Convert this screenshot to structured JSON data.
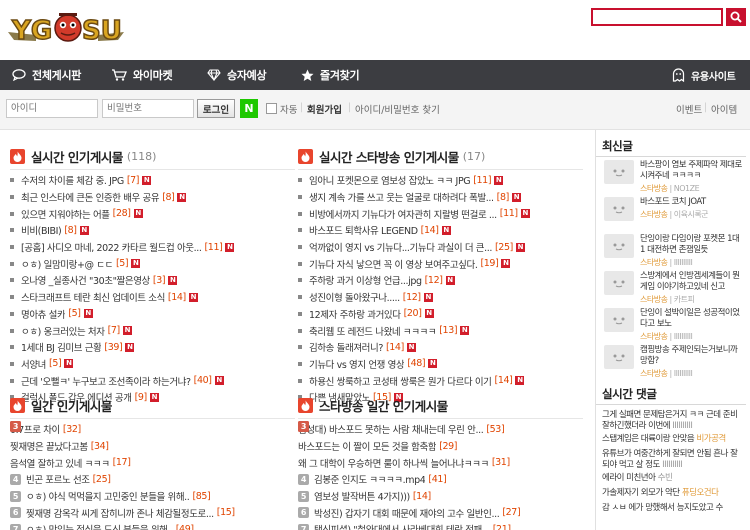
{
  "header": {
    "logo_text": "YG SU",
    "search_placeholder": ""
  },
  "nav": {
    "items": [
      {
        "label": "전체게시판",
        "icon": "chat-bubble-icon"
      },
      {
        "label": "와이마켓",
        "icon": "cart-icon"
      },
      {
        "label": "승자예상",
        "icon": "diamond-icon"
      },
      {
        "label": "즐겨찾기",
        "icon": "star-icon"
      }
    ],
    "right_label": "유용사이트",
    "right_icon": "ghost-icon"
  },
  "login": {
    "id_placeholder": "아이디",
    "pw_placeholder": "비밀번호",
    "login_button": "로그인",
    "naver_label": "N",
    "auto_label": "자동",
    "join_label": "회원가입",
    "find_label": "아이디/비밀번호 찾기",
    "event_label": "이벤트",
    "item_label": "아이템",
    "sep": "|"
  },
  "hot_posts": {
    "title": "실시간 인기게시물",
    "count": "(118)",
    "items": [
      {
        "t": "수저의 차이를 체감 중. JPG",
        "c": "[7]"
      },
      {
        "t": "최근 인스타에 큰돈 인증한 배우 공유",
        "c": "[8]"
      },
      {
        "t": "있으면 지워야하는 어플",
        "c": "[28]"
      },
      {
        "t": "비비(BIBI)",
        "c": "[8]"
      },
      {
        "t": "[공홈] 사디오 마네, 2022 카타르 월드컵 아웃...",
        "c": "[11]"
      },
      {
        "t": "ㅇㅎ) 일맘미랑+@ ㄷㄷ",
        "c": "[5]"
      },
      {
        "t": "오나영 _실종사건 \"30초\"짤은영상",
        "c": "[3]"
      },
      {
        "t": "스타크래프트 테란 최신 업데이트 소식",
        "c": "[14]"
      },
      {
        "t": "명아츄 설카",
        "c": "[5]"
      },
      {
        "t": "ㅇㅎ) 옹크러있는 처자",
        "c": "[7]"
      },
      {
        "t": "1세대 BJ 김미브 근황",
        "c": "[39]"
      },
      {
        "t": "서양녀",
        "c": "[5]"
      },
      {
        "t": "근데 '오뻘ㅋ' 누구보고 조선족이라 하는거냐?",
        "c": "[40]"
      },
      {
        "t": "걸럭시 폴드 갑우 에디션 공개",
        "c": "[9]"
      }
    ]
  },
  "star_posts": {
    "title": "실시간 스타방송 인기게시물",
    "count": "(17)",
    "items": [
      {
        "t": "임아니 포켓몬으로 염보성 잡았노 ㅋㅋ JPG",
        "c": "[11]"
      },
      {
        "t": "생지 계속 가를 쓰고 웃는 얼굴로 대하려다 폭발...",
        "c": "[8]"
      },
      {
        "t": "비방에서까지 기뉴다가 여자관히 지랄병 떤걸로 ...",
        "c": "[11]"
      },
      {
        "t": "바스포드 퇴학사유  LEGEND",
        "c": "[14]"
      },
      {
        "t": "억까없이 영지 vs 기뉴다...기뉴다 과실이 더 큰...",
        "c": "[25]"
      },
      {
        "t": "기뉴다 자식 낳으면 꼭 이 영상 보여주고싶다.",
        "c": "[19]"
      },
      {
        "t": "주하랑 과거 이상형 언급...jpg",
        "c": "[12]"
      },
      {
        "t": "성진이형 돌아왔구나.....",
        "c": "[12]"
      },
      {
        "t": "12제자 주하랑 과거있다",
        "c": "[20]"
      },
      {
        "t": "축리웹 또 레전드 나왔네 ㅋㅋㅋㅋ",
        "c": "[13]"
      },
      {
        "t": "김하송 돌래져러니?",
        "c": "[14]"
      },
      {
        "t": "기뉴다 vs 영지 언쟁 영상",
        "c": "[48]"
      },
      {
        "t": "하용신 쌍룩하고 코성태 쌍룩은 뭔가 다르다 이기",
        "c": "[14]"
      },
      {
        "t": "다쁜 냄새맡았노",
        "c": "[15]"
      }
    ]
  },
  "daily_posts": {
    "title": "일간 인기게시물",
    "items": [
      {
        "n": "1",
        "t": "0.7프로 차이",
        "c": "[32]"
      },
      {
        "n": "2",
        "t": "찢재명은 끝났다고봄",
        "c": "[34]"
      },
      {
        "n": "3",
        "t": "음석열 잘하고 있네 ㅋㅋㅋ",
        "c": "[17]"
      },
      {
        "n": "4",
        "t": "빈곤 포르노 선조",
        "c": "[25]"
      },
      {
        "n": "5",
        "t": "ㅇㅎ) 야식 먹먹을지 고민중인 분들을 위해..",
        "c": "[85]"
      },
      {
        "n": "6",
        "t": "찢재명 감옥각 씨게 잡히니까 존나 체감될정도로...",
        "c": "[15]"
      },
      {
        "n": "7",
        "t": "ㅇㅎ) 맛있는 점심을 드신 분들을 위해..",
        "c": "[49]"
      }
    ]
  },
  "star_daily": {
    "title": "스타방송 일간 인기게시물",
    "items": [
      {
        "n": "1",
        "t": "김성대) 바스포드 못하는 사람 채내는데 우린 안...",
        "c": "[53]"
      },
      {
        "n": "2",
        "t": "바스포드는 이 짤이 모든 것을 함축함",
        "c": "[29]"
      },
      {
        "n": "3",
        "t": "왜 그 대학이 우승하면 룰이 하나씩 늘어나냐ㅋㅋㅋ",
        "c": "[31]"
      },
      {
        "n": "4",
        "t": "김봉준 인지도 ㅋㅋㅋㅋ.mp4",
        "c": "[41]"
      },
      {
        "n": "5",
        "t": "염보성 발작버튼 4가지)))",
        "c": "[14]"
      },
      {
        "n": "6",
        "t": "박성진) 갑자기 대회 때문에 재야의 고수 일반인...",
        "c": "[27]"
      },
      {
        "n": "7",
        "t": "택신피셜) \"철와대에서 사라베대회 테란 전패...",
        "c": "[21]"
      }
    ]
  },
  "sidebar": {
    "recent_title": "최신글",
    "recent": [
      {
        "text": "바스팡이 염보 주제파악 제대로 시켜주네 ㅋㅋㅋㅋ",
        "board": "스타방송",
        "user": "NO1ZE"
      },
      {
        "text": "바스포드 코치 JOAT",
        "board": "스타방송",
        "user": "이육시록군"
      },
      {
        "text": "단잉이랑 다임이랑 포켓몬 1대1 대전하면 존잼일듯",
        "board": "스타방송",
        "user": "IIIIIIIIII"
      },
      {
        "text": "스방계에서 인방겜세계들이 뭔게임 이야기하고있네 신고",
        "board": "스타방송",
        "user": "카트피"
      },
      {
        "text": "단잉이 설박이일은 성공적이었다고 보노",
        "board": "스타방송",
        "user": "IIIIIIIIII"
      },
      {
        "text": "캠핑방송 주제인되는거보니까 망함?",
        "board": "스타방송",
        "user": "IIIIIIIIII"
      }
    ],
    "comments_title": "실시간 댓글",
    "comments": [
      {
        "text": "그게 실패면 문제탐은거지 ㅋㅋ 근데 준비잘하긴했더라 이번에",
        "auth": "IIIIIIIIII",
        "o": false
      },
      {
        "text": "스탭계임은 대륙이랑 안맞음",
        "auth": "비가공격",
        "o": true
      },
      {
        "text": "유튜브가 여중간하게 잘되면 안됨 흔나 잘되야 먹고 살 정도",
        "auth": "IIIIIIIIII",
        "o": false
      },
      {
        "text": "에라이 미친년아",
        "auth": "수빈",
        "o": false
      },
      {
        "text": "가솔제자기 외모가 약단",
        "auth": "퓨딩오건다",
        "o": true
      },
      {
        "text": "감 ㅅㅂ 에가 망했해서 능지도았고 수",
        "auth": "",
        "o": false
      }
    ]
  },
  "colors": {
    "brand": "#c8102e",
    "nav_bg": "#3c3d41",
    "count": "#e04400",
    "new_badge": "#d21e2b",
    "naver": "#1ec800"
  }
}
